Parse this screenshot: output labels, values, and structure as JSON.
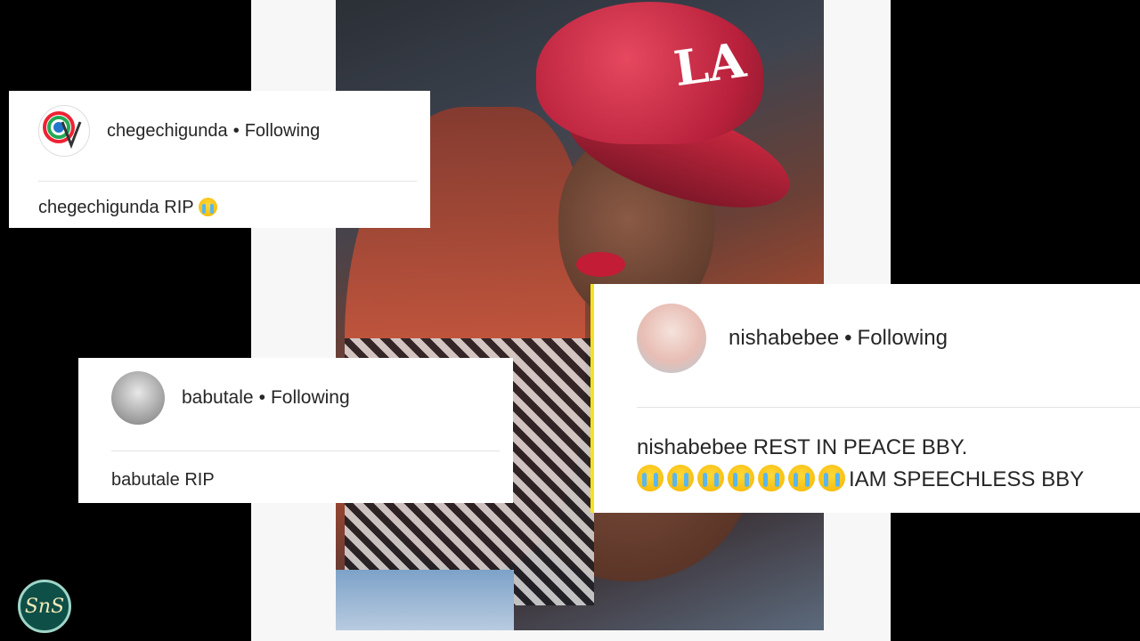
{
  "comments": [
    {
      "username": "chegechigunda",
      "follow_status": "Following",
      "separator": "•",
      "comment_user": "chegechigunda",
      "comment_text": "RIP",
      "emoji_count": 1,
      "avatar_label": "UVM"
    },
    {
      "username": "babutale",
      "follow_status": "Following",
      "separator": "•",
      "comment_user": "babutale",
      "comment_text": "RIP"
    },
    {
      "username": "nishabebee",
      "follow_status": "Following",
      "separator": "•",
      "comment_user": "nishabebee",
      "comment_text_line1": "REST IN PEACE BBY.",
      "emoji_count": 7,
      "comment_text_line2": "IAM SPEECHLESS BBY"
    }
  ],
  "photo": {
    "cap_logo": "LA"
  },
  "watermark": {
    "text": "SnS"
  },
  "colors": {
    "background": "#000000",
    "card": "#ffffff",
    "text": "#262626",
    "cap": "#c9283f",
    "highlight_edge": "#f6e21a"
  }
}
